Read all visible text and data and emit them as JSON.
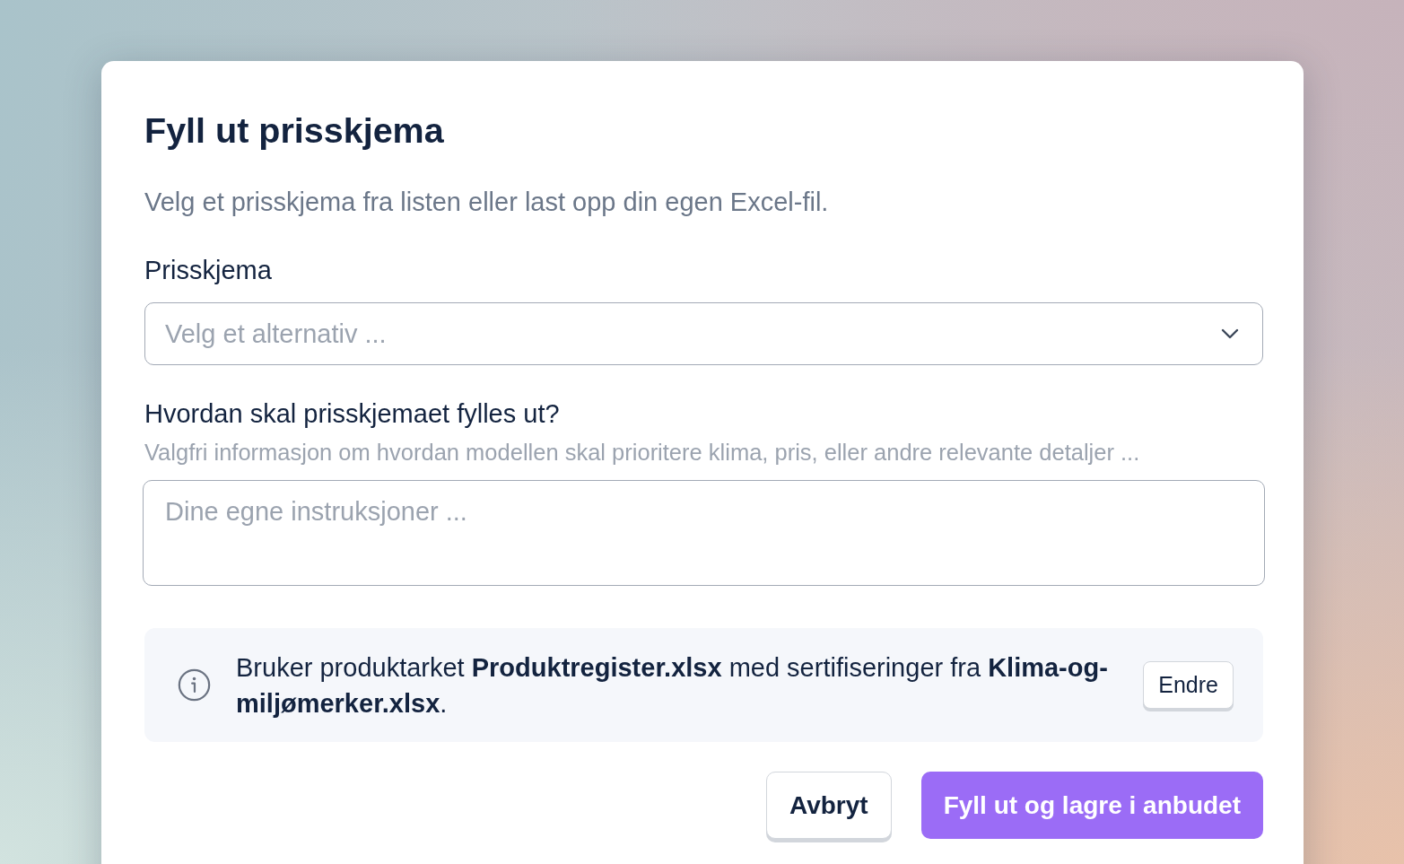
{
  "dialog": {
    "title": "Fyll ut prisskjema",
    "description": "Velg et prisskjema fra listen eller last opp din egen Excel-fil.",
    "fields": [
      {
        "kind": "select",
        "label": "Prisskjema",
        "placeholder": "Velg et alternativ ..."
      },
      {
        "kind": "textarea",
        "label": "Hvordan skal prisskjemaet fylles ut?",
        "hint": "Valgfri informasjon om hvordan modellen skal prioritere klima, pris, eller andre relevante detaljer ...",
        "placeholder": "Dine egne instruksjoner ..."
      }
    ],
    "notice": {
      "text": "Bruker produktarket **Produktregister.xlsx** med sertifiseringer fra **Klima-og-miljømerker.xlsx**.",
      "button": "Endre"
    },
    "buttons": [
      {
        "kind": "secondary",
        "label": "Avbryt"
      },
      {
        "kind": "primary",
        "label": "Fyll ut og lagre i anbudet"
      }
    ]
  }
}
